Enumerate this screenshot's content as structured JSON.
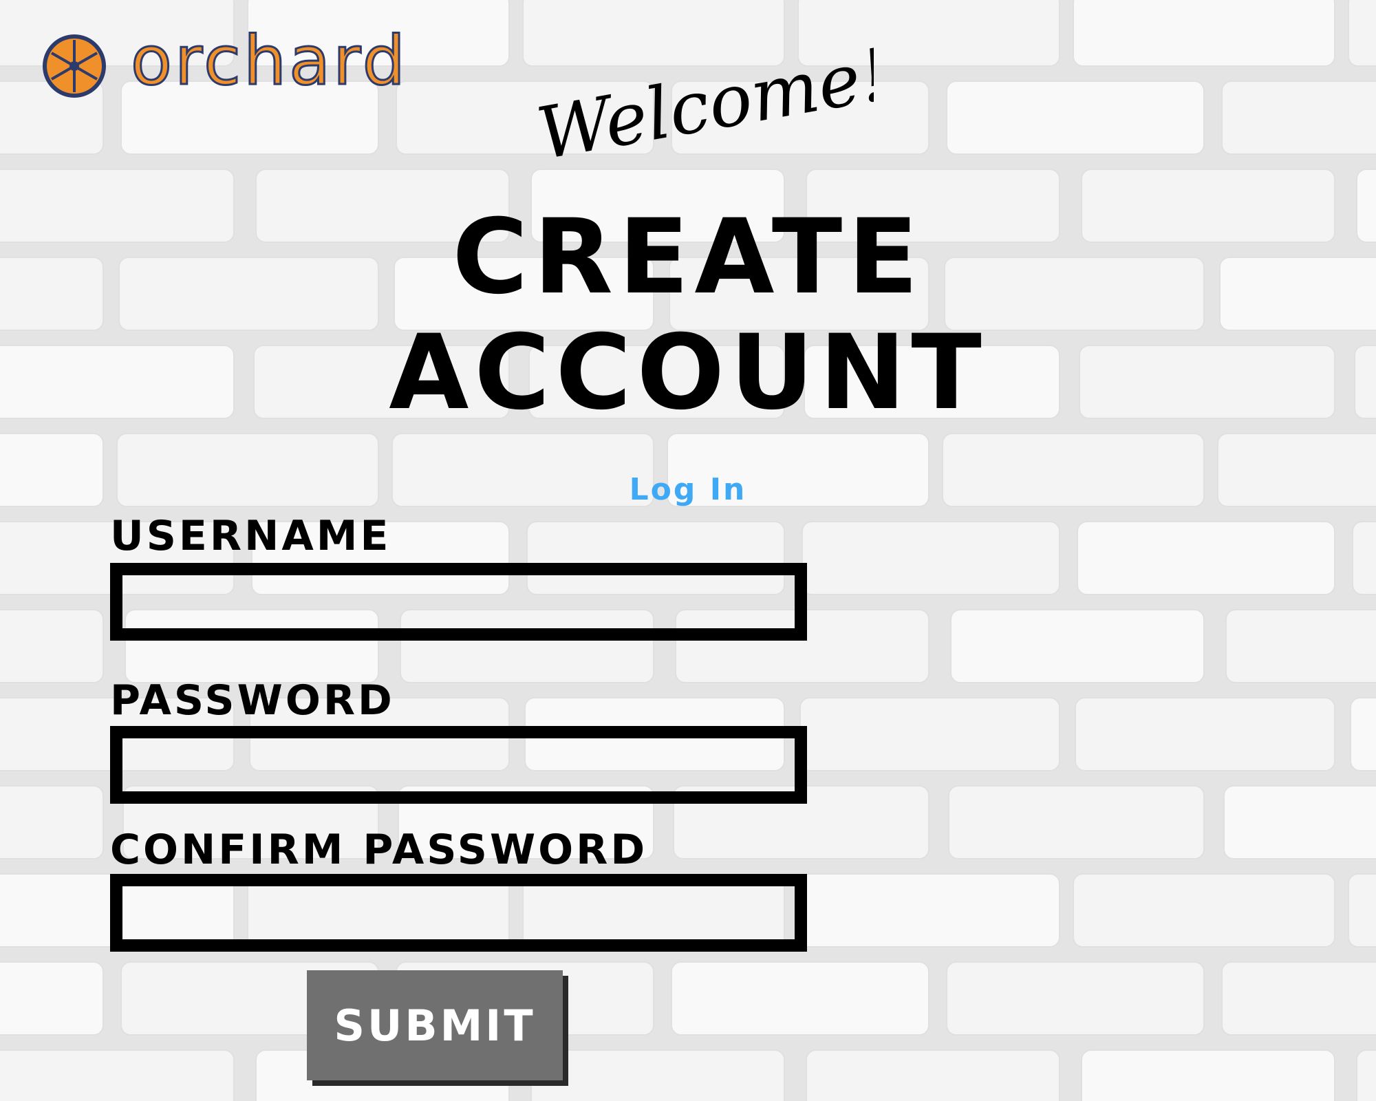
{
  "brand": {
    "name": "orchard",
    "logo_icon": "orange-slice-icon",
    "colors": {
      "orange": "#f0902b",
      "navy": "#2c3b6b"
    }
  },
  "welcome_text": "Welcome!",
  "title": {
    "line1": "CREATE",
    "line2": "ACCOUNT"
  },
  "login_link": "Log In",
  "form": {
    "username_label": "USERNAME",
    "username_value": "",
    "password_label": "PASSWORD",
    "password_value": "",
    "confirm_label": "CONFIRM PASSWORD",
    "confirm_value": "",
    "submit_label": "SUBMIT"
  },
  "colors": {
    "link": "#3fa9f5",
    "button": "#707070",
    "border": "#000000",
    "background": "#ececec"
  }
}
